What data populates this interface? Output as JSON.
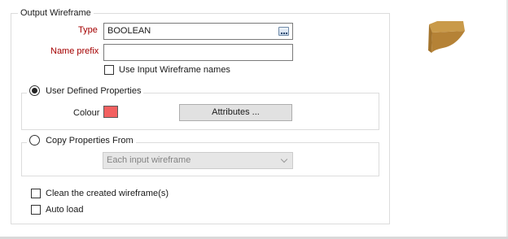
{
  "output_wireframe": {
    "legend": "Output Wireframe",
    "type_label": "Type",
    "type_value": "BOOLEAN",
    "name_prefix_label": "Name prefix",
    "name_prefix_value": "",
    "use_input_names_label": "Use Input Wireframe names",
    "use_input_names_checked": false
  },
  "user_defined": {
    "label": "User Defined Properties",
    "selected": true,
    "colour_label": "Colour",
    "colour_value": "#f26060",
    "attributes_button": "Attributes ..."
  },
  "copy_from": {
    "label": "Copy Properties From",
    "selected": false,
    "select_value": "Each input wireframe"
  },
  "options": {
    "clean_label": "Clean the created wireframe(s)",
    "clean_checked": false,
    "auto_load_label": "Auto load",
    "auto_load_checked": false
  },
  "icons": {
    "preview": "boolean-shape-icon",
    "browse": "browse-icon"
  }
}
